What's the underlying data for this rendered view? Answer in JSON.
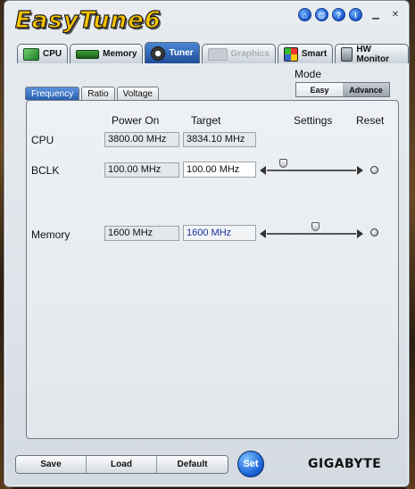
{
  "app": {
    "title": "EasyTune6",
    "brand": "GIGABYTE"
  },
  "title_icons": [
    "home-icon",
    "at-icon",
    "help-icon",
    "info-icon"
  ],
  "window_buttons": [
    "minimize-icon",
    "close-icon"
  ],
  "tabs": [
    {
      "label": "CPU",
      "active": false,
      "disabled": false
    },
    {
      "label": "Memory",
      "active": false,
      "disabled": false
    },
    {
      "label": "Tuner",
      "active": true,
      "disabled": false
    },
    {
      "label": "Graphics",
      "active": false,
      "disabled": true
    },
    {
      "label": "Smart",
      "active": false,
      "disabled": false
    },
    {
      "label": "HW Monitor",
      "active": false,
      "disabled": false
    }
  ],
  "mode": {
    "label": "Mode",
    "options": [
      "Easy",
      "Advance"
    ],
    "selected": "Advance"
  },
  "subtabs": [
    {
      "label": "Frequency",
      "active": true
    },
    {
      "label": "Ratio",
      "active": false
    },
    {
      "label": "Voltage",
      "active": false
    }
  ],
  "headers": {
    "power_on": "Power On",
    "target": "Target",
    "settings": "Settings",
    "reset": "Reset"
  },
  "rows": {
    "cpu": {
      "label": "CPU",
      "power_on": "3800.00 MHz",
      "target": "3834.10 MHz"
    },
    "bclk": {
      "label": "BCLK",
      "power_on": "100.00 MHz",
      "target": "100.00 MHz",
      "slider_level": 0.15
    },
    "memory": {
      "label": "Memory",
      "power_on": "1600 MHz",
      "target": "1600 MHz",
      "slider_level": 0.55
    }
  },
  "bottom": {
    "save": "Save",
    "load": "Load",
    "default": "Default",
    "set": "Set"
  },
  "colors": {
    "accent": "#1f4e98",
    "target_text": "#1a2f9a"
  }
}
